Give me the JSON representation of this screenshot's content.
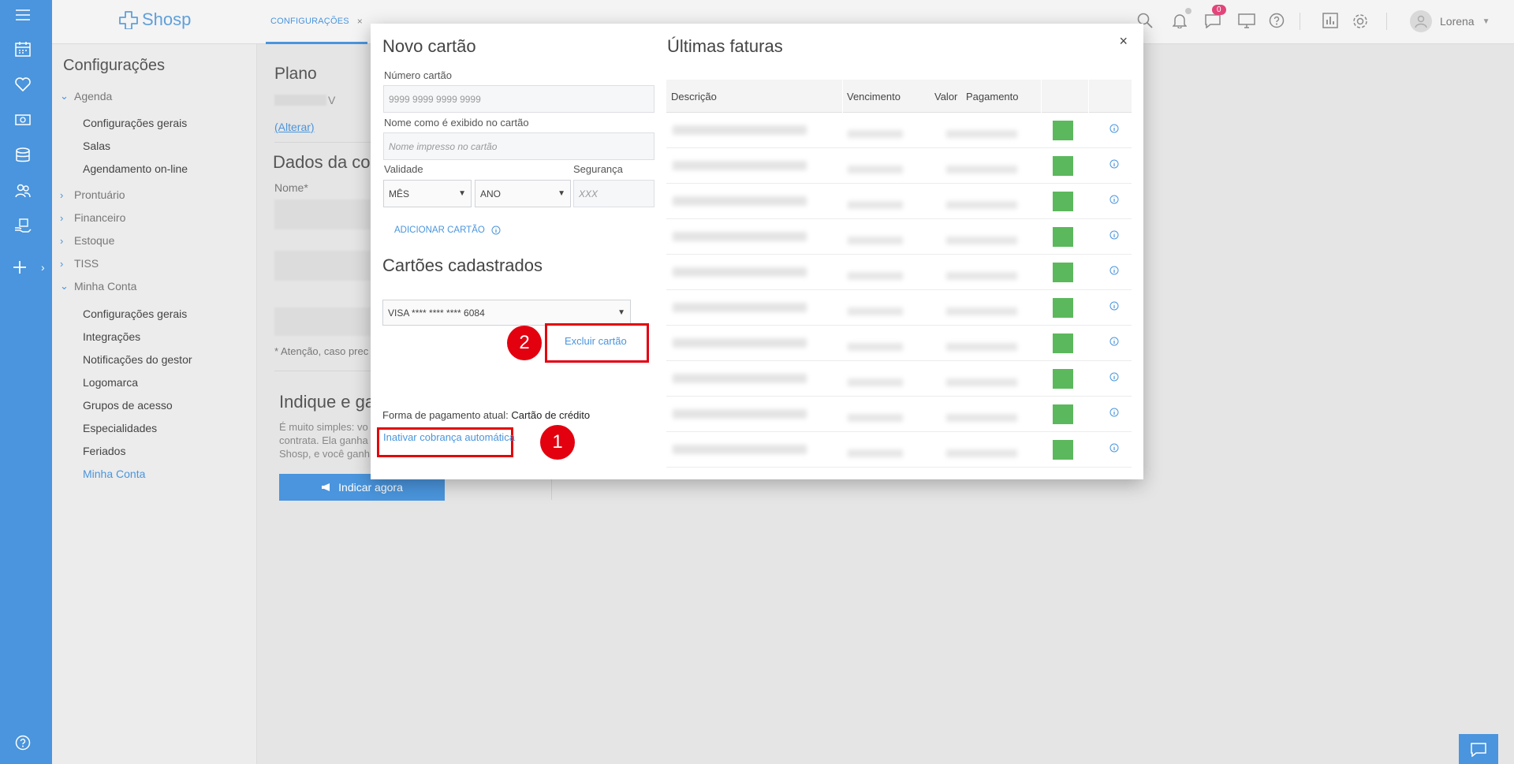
{
  "app": {
    "brand": "Shosp",
    "user": "Lorena",
    "notification_count": "0",
    "colors": {
      "accent": "#4a95dd",
      "badge": "#e2457a",
      "status_paid": "#5cb85c",
      "annotation": "#e3000f"
    }
  },
  "tabs": [
    {
      "label": "CONFIGURAÇÕES",
      "close": "×"
    }
  ],
  "sidebar": {
    "title": "Configurações",
    "groups": [
      {
        "label": "Agenda",
        "expanded": true,
        "items": [
          "Configurações gerais",
          "Salas",
          "Agendamento on-line"
        ]
      },
      {
        "label": "Prontuário"
      },
      {
        "label": "Financeiro"
      },
      {
        "label": "Estoque"
      },
      {
        "label": "TISS"
      },
      {
        "label": "Minha Conta",
        "expanded": true,
        "items": [
          "Configurações gerais",
          "Integrações",
          "Notificações do gestor",
          "Logomarca",
          "Grupos de acesso",
          "Especialidades",
          "Feriados",
          "Minha Conta"
        ]
      }
    ]
  },
  "background": {
    "plano_title": "Plano",
    "plano_suffix": "V",
    "alterar": "(Alterar)",
    "dados_title": "Dados da co",
    "nome_label": "Nome*",
    "atencao": "* Atenção, caso prec",
    "indique_title": "Indique e ga",
    "indique_text": [
      "É muito simples: vo",
      "contrata. Ela ganha",
      "Shosp, e você ganh"
    ],
    "indicar_button": "Indicar agora"
  },
  "modal": {
    "close": "×",
    "novo": {
      "title": "Novo cartão",
      "numero_label": "Número cartão",
      "numero_placeholder": "9999 9999 9999 9999",
      "nome_label": "Nome como é exibido no cartão",
      "nome_placeholder": "Nome impresso no cartão",
      "validade_label": "Validade",
      "mes": "MÊS",
      "ano": "ANO",
      "seguranca_label": "Segurança",
      "seguranca_placeholder": "XXX",
      "adicionar": "ADICIONAR CARTÃO"
    },
    "cadastrados": {
      "title": "Cartões cadastrados",
      "selected_card": "VISA **** **** **** 6084",
      "excluir": "Excluir cartão"
    },
    "pagamento": {
      "label": "Forma de pagamento atual:",
      "value": "Cartão de crédito",
      "inativar": "Inativar cobrança automática"
    },
    "annotations": [
      "1",
      "2"
    ],
    "faturas": {
      "title": "Últimas faturas",
      "columns": [
        "Descrição",
        "Vencimento",
        "Valor",
        "Pagamento"
      ],
      "rows": [
        {
          "status": "pago"
        },
        {
          "status": "pago"
        },
        {
          "status": "pago"
        },
        {
          "status": "pago"
        },
        {
          "status": "pago"
        },
        {
          "status": "pago"
        },
        {
          "status": "pago"
        },
        {
          "status": "pago"
        },
        {
          "status": "pago"
        },
        {
          "status": "pago"
        }
      ]
    }
  }
}
